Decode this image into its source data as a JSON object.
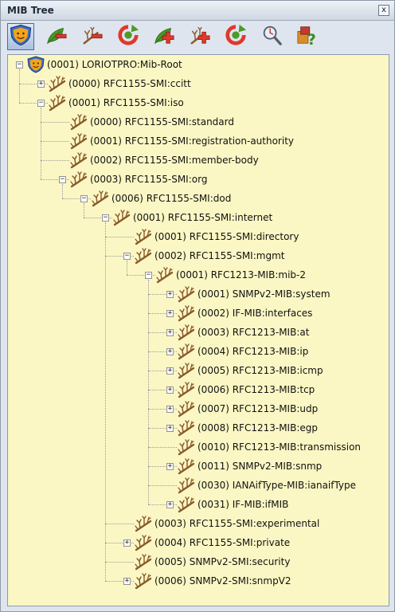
{
  "window": {
    "title": "MIB Tree",
    "close_label": "x"
  },
  "toolbar": {
    "buttons": [
      {
        "name": "mib-root-button",
        "icon": "shield-face-icon",
        "active": true
      },
      {
        "name": "remove-node-button",
        "icon": "leaf-minus-icon"
      },
      {
        "name": "collapse-branch-button",
        "icon": "branch-minus-icon"
      },
      {
        "name": "refresh-button",
        "icon": "refresh-icon"
      },
      {
        "name": "add-node-button",
        "icon": "leaf-plus-icon"
      },
      {
        "name": "expand-branch-button",
        "icon": "branch-plus-icon"
      },
      {
        "name": "refresh-all-button",
        "icon": "refresh-icon"
      },
      {
        "name": "search-button",
        "icon": "magnifier-icon"
      },
      {
        "name": "help-button",
        "icon": "help-icon"
      }
    ]
  },
  "tree": {
    "nodes": [
      {
        "label": "(0001) LORIOTPRO:Mib-Root",
        "depth": 0,
        "toggle": "minus",
        "icon": "root-shield-icon"
      },
      {
        "label": "(0000) RFC1155-SMI:ccitt",
        "depth": 1,
        "toggle": "plus",
        "icon": "branch-icon"
      },
      {
        "label": "(0001) RFC1155-SMI:iso",
        "depth": 1,
        "toggle": "minus",
        "icon": "branch-icon"
      },
      {
        "label": "(0000) RFC1155-SMI:standard",
        "depth": 2,
        "toggle": "none",
        "icon": "branch-icon"
      },
      {
        "label": "(0001) RFC1155-SMI:registration-authority",
        "depth": 2,
        "toggle": "none",
        "icon": "branch-icon"
      },
      {
        "label": "(0002) RFC1155-SMI:member-body",
        "depth": 2,
        "toggle": "none",
        "icon": "branch-icon"
      },
      {
        "label": "(0003) RFC1155-SMI:org",
        "depth": 2,
        "toggle": "minus",
        "icon": "branch-icon"
      },
      {
        "label": "(0006) RFC1155-SMI:dod",
        "depth": 3,
        "toggle": "minus",
        "icon": "branch-icon"
      },
      {
        "label": "(0001) RFC1155-SMI:internet",
        "depth": 4,
        "toggle": "minus",
        "icon": "branch-icon"
      },
      {
        "label": "(0001) RFC1155-SMI:directory",
        "depth": 5,
        "toggle": "none",
        "icon": "branch-icon"
      },
      {
        "label": "(0002) RFC1155-SMI:mgmt",
        "depth": 5,
        "toggle": "minus",
        "icon": "branch-icon"
      },
      {
        "label": "(0001) RFC1213-MIB:mib-2",
        "depth": 6,
        "toggle": "minus",
        "icon": "branch-icon"
      },
      {
        "label": "(0001) SNMPv2-MIB:system",
        "depth": 7,
        "toggle": "plus",
        "icon": "branch-icon"
      },
      {
        "label": "(0002) IF-MIB:interfaces",
        "depth": 7,
        "toggle": "plus",
        "icon": "branch-icon"
      },
      {
        "label": "(0003) RFC1213-MIB:at",
        "depth": 7,
        "toggle": "plus",
        "icon": "branch-icon"
      },
      {
        "label": "(0004) RFC1213-MIB:ip",
        "depth": 7,
        "toggle": "plus",
        "icon": "branch-icon"
      },
      {
        "label": "(0005) RFC1213-MIB:icmp",
        "depth": 7,
        "toggle": "plus",
        "icon": "branch-icon"
      },
      {
        "label": "(0006) RFC1213-MIB:tcp",
        "depth": 7,
        "toggle": "plus",
        "icon": "branch-icon"
      },
      {
        "label": "(0007) RFC1213-MIB:udp",
        "depth": 7,
        "toggle": "plus",
        "icon": "branch-icon"
      },
      {
        "label": "(0008) RFC1213-MIB:egp",
        "depth": 7,
        "toggle": "plus",
        "icon": "branch-icon"
      },
      {
        "label": "(0010) RFC1213-MIB:transmission",
        "depth": 7,
        "toggle": "none",
        "icon": "branch-icon"
      },
      {
        "label": "(0011) SNMPv2-MIB:snmp",
        "depth": 7,
        "toggle": "plus",
        "icon": "branch-icon"
      },
      {
        "label": "(0030) IANAifType-MIB:ianaifType",
        "depth": 7,
        "toggle": "none",
        "icon": "branch-icon"
      },
      {
        "label": "(0031) IF-MIB:ifMIB",
        "depth": 7,
        "toggle": "plus",
        "icon": "branch-icon"
      },
      {
        "label": "(0003) RFC1155-SMI:experimental",
        "depth": 5,
        "toggle": "none",
        "icon": "branch-icon"
      },
      {
        "label": "(0004) RFC1155-SMI:private",
        "depth": 5,
        "toggle": "plus",
        "icon": "branch-icon"
      },
      {
        "label": "(0005) SNMPv2-SMI:security",
        "depth": 5,
        "toggle": "none",
        "icon": "branch-icon"
      },
      {
        "label": "(0006) SNMPv2-SMI:snmpV2",
        "depth": 5,
        "toggle": "plus",
        "icon": "branch-icon"
      }
    ]
  },
  "colors": {
    "tree_bg": "#fbf7c4",
    "branch": "#8a5a2b",
    "leaf_green": "#4c9a2a",
    "remove_red": "#d43b2f",
    "add_red": "#e0382c",
    "shield_blue": "#3b6fc4",
    "shield_orange": "#f4a41c"
  }
}
